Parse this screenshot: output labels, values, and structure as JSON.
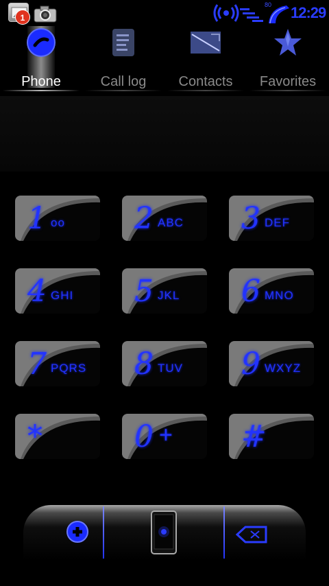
{
  "status_bar": {
    "notification_count": "1",
    "battery_percent": "80",
    "clock": "12:29"
  },
  "tabs": [
    {
      "label": "Phone",
      "icon": "phone-icon",
      "active": true
    },
    {
      "label": "Call log",
      "icon": "call-log-icon",
      "active": false
    },
    {
      "label": "Contacts",
      "icon": "contacts-icon",
      "active": false
    },
    {
      "label": "Favorites",
      "icon": "star-icon",
      "active": false
    }
  ],
  "display": {
    "number": ""
  },
  "keypad": [
    {
      "digit": "1",
      "letters": "oo"
    },
    {
      "digit": "2",
      "letters": "ABC"
    },
    {
      "digit": "3",
      "letters": "DEF"
    },
    {
      "digit": "4",
      "letters": "GHI"
    },
    {
      "digit": "5",
      "letters": "JKL"
    },
    {
      "digit": "6",
      "letters": "MNO"
    },
    {
      "digit": "7",
      "letters": "PQRS"
    },
    {
      "digit": "8",
      "letters": "TUV"
    },
    {
      "digit": "9",
      "letters": "WXYZ"
    },
    {
      "digit": "*",
      "letters": ""
    },
    {
      "digit": "0",
      "letters": "+"
    },
    {
      "digit": "#",
      "letters": ""
    }
  ],
  "bottom_bar": {
    "left_icon": "add-contact-icon",
    "center_icon": "phone-device-icon",
    "right_icon": "backspace-icon"
  },
  "colors": {
    "accent": "#2233ff",
    "background": "#000000",
    "tab_inactive": "#8a8a8a"
  }
}
